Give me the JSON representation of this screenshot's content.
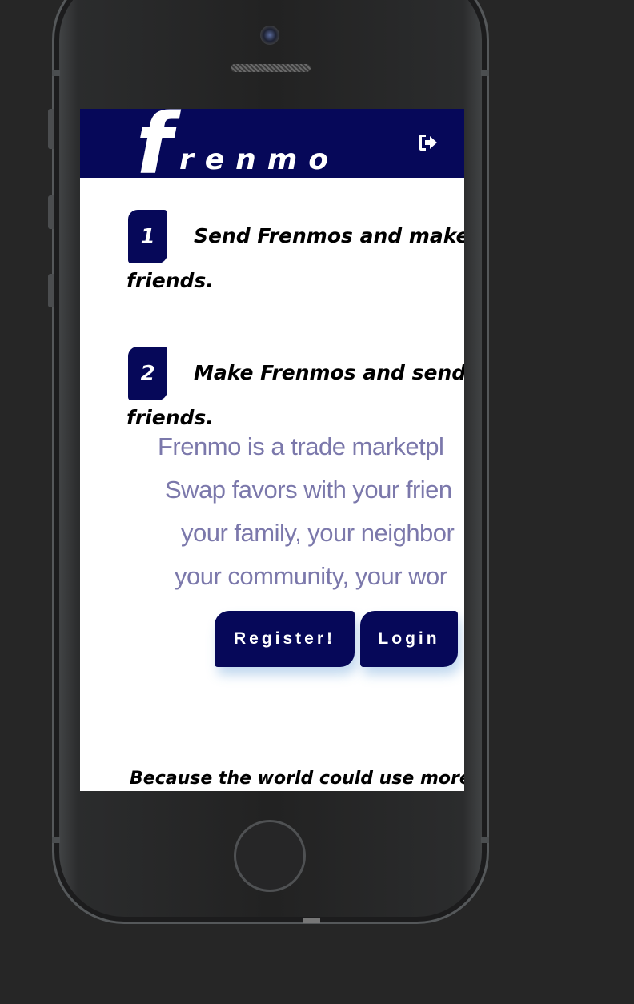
{
  "header": {
    "logo_initial": "f",
    "logo_rest": "renmo",
    "logout_icon": "logout-icon"
  },
  "steps": [
    {
      "number": "1",
      "text": "Send Frenmos and make",
      "continuation": "friends."
    },
    {
      "number": "2",
      "text": "Make Frenmos and send",
      "continuation": "friends."
    }
  ],
  "description": [
    "Frenmo is a trade marketpl",
    "Swap favors with your frien",
    "your family, your neighbor",
    "your community, your wor"
  ],
  "buttons": {
    "register": "Register!",
    "login": "Login"
  },
  "tagline": "Because the world could use more",
  "colors": {
    "brand_navy": "#060859",
    "description_text": "#7b78ab",
    "phone_background": "#262626"
  }
}
